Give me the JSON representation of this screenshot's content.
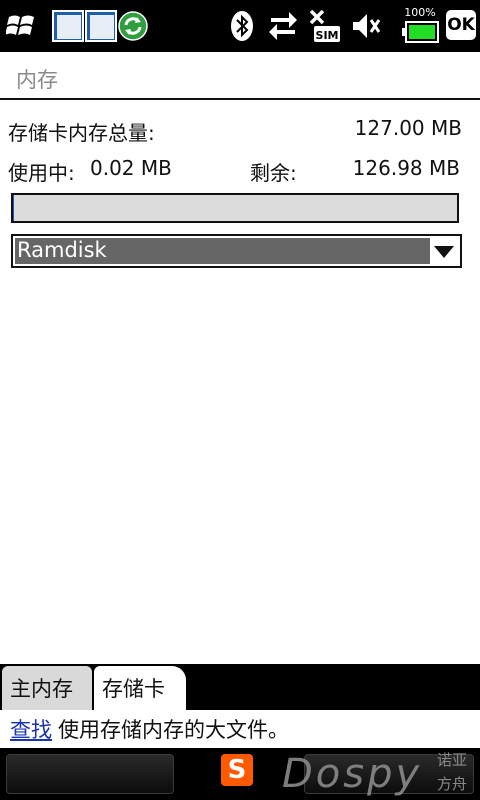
{
  "status_bar": {
    "battery_percent": "100%",
    "ok_label": "OK",
    "icons": [
      "windows-start-icon",
      "taskbar-window-icon",
      "sync-icon",
      "bluetooth-icon",
      "data-transfer-icon",
      "no-sim-icon",
      "volume-muted-icon",
      "battery-icon",
      "ok-icon"
    ],
    "sim_label": "SIM"
  },
  "title": "内存",
  "storage": {
    "total_label": "存储卡内存总量:",
    "total_value": "127.00 MB",
    "used_label": "使用中:",
    "used_value": "0.02 MB",
    "free_label": "剩余:",
    "free_value": "126.98 MB",
    "usage_fraction": 0.0002
  },
  "dropdown": {
    "selected": "Ramdisk"
  },
  "tabs": [
    {
      "label": "主内存",
      "active": false
    },
    {
      "label": "存储卡",
      "active": true
    }
  ],
  "help": {
    "link_text": "查找",
    "rest_text": "使用存储内存的大文件。"
  },
  "softbar": {
    "ime_icon_letter": "S",
    "watermark": "Dospy",
    "watermark_cn_line1": "诺亚",
    "watermark_cn_line2": "方舟"
  },
  "colors": {
    "status_bar_bg": "#000000",
    "link": "#1a33b0",
    "battery": "#22dd22",
    "sogou": "#ff5a00"
  }
}
